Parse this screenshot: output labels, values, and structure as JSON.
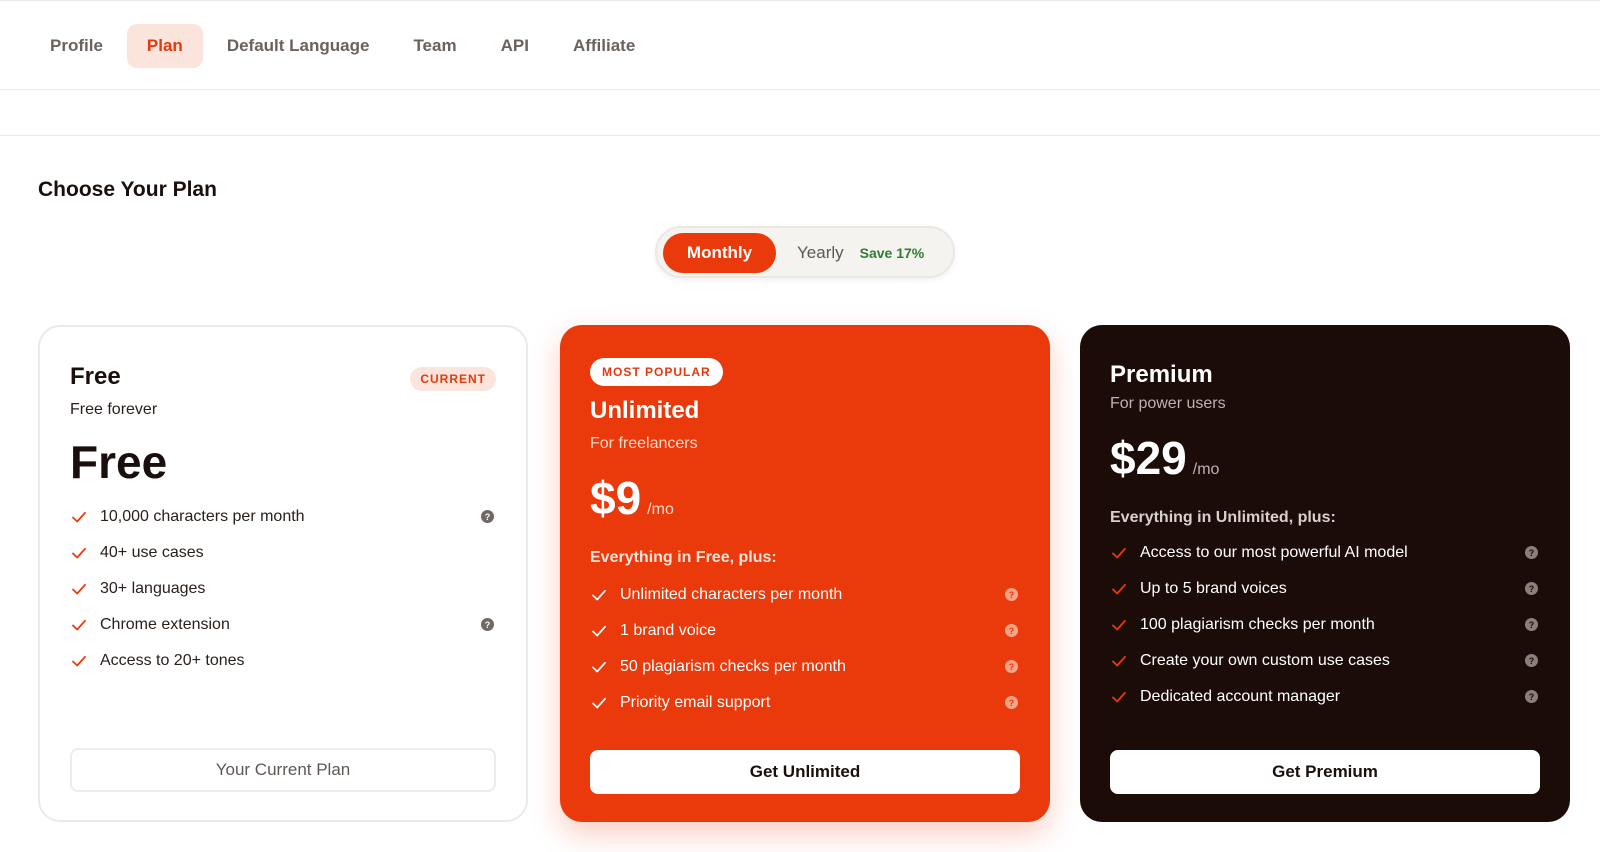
{
  "tabs": [
    "Profile",
    "Plan",
    "Default Language",
    "Team",
    "API",
    "Affiliate"
  ],
  "active_tab": "Plan",
  "page_title": "Choose Your Plan",
  "billing_toggle": {
    "monthly_label": "Monthly",
    "yearly_label": "Yearly",
    "save_label": "Save 17%",
    "selected": "Monthly"
  },
  "plans": [
    {
      "name": "Free",
      "badge": "CURRENT",
      "subtitle": "Free forever",
      "price": "Free",
      "per": "",
      "intro": "",
      "features": [
        {
          "text": "10,000 characters per month",
          "help": true
        },
        {
          "text": "40+ use cases",
          "help": false
        },
        {
          "text": "30+ languages",
          "help": false
        },
        {
          "text": "Chrome extension",
          "help": true
        },
        {
          "text": "Access to 20+ tones",
          "help": false
        }
      ],
      "cta": "Your Current Plan"
    },
    {
      "name": "Unlimited",
      "badge": "MOST POPULAR",
      "subtitle": "For freelancers",
      "price": "$9",
      "per": "/mo",
      "intro": "Everything in Free, plus:",
      "features": [
        {
          "text": "Unlimited characters per month",
          "help": true
        },
        {
          "text": "1 brand voice",
          "help": true
        },
        {
          "text": "50 plagiarism checks per month",
          "help": true
        },
        {
          "text": "Priority email support",
          "help": true
        }
      ],
      "cta": "Get Unlimited"
    },
    {
      "name": "Premium",
      "badge": "",
      "subtitle": "For power users",
      "price": "$29",
      "per": "/mo",
      "intro": "Everything in Unlimited, plus:",
      "features": [
        {
          "text": "Access to our most powerful AI model",
          "help": true
        },
        {
          "text": "Up to 5 brand voices",
          "help": true
        },
        {
          "text": "100 plagiarism checks per month",
          "help": true
        },
        {
          "text": "Create your own custom use cases",
          "help": true
        },
        {
          "text": "Dedicated account manager",
          "help": true
        }
      ],
      "cta": "Get Premium"
    }
  ],
  "help_glyph": "?",
  "colors": {
    "accent": "#ea3a0b",
    "accent_soft": "#fbe4dc",
    "dark": "#1c0c08",
    "save_green": "#2e7d32"
  }
}
